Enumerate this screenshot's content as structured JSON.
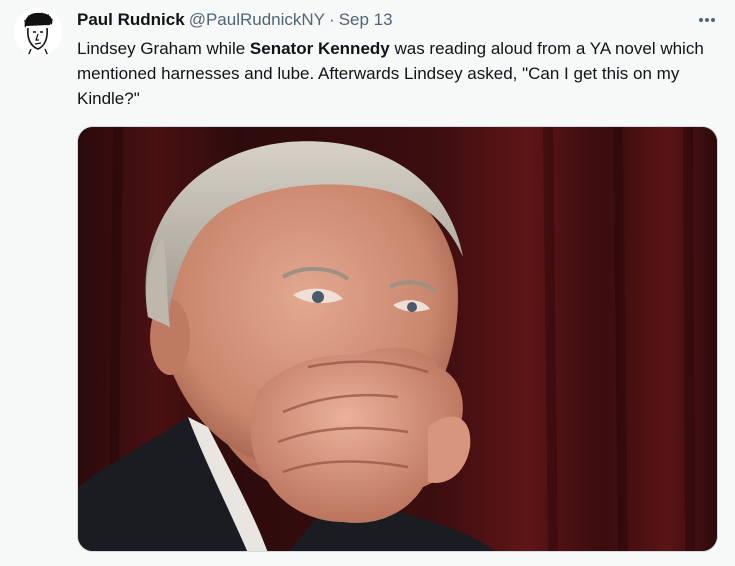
{
  "tweet": {
    "author_name": "Paul Rudnick",
    "author_handle": "@PaulRudnickNY",
    "separator": "·",
    "date": "Sep 13",
    "text": {
      "part1": "Lindsey Graham while ",
      "bold": "Senator Kennedy",
      "part2": " was reading aloud from a YA novel which mentioned harnesses and lube. Afterwards Lindsey asked, \"Can I get this on my Kindle?\""
    },
    "icons": {
      "more": "more-horizontal-icon",
      "avatar": "caricature-avatar"
    }
  },
  "colors": {
    "background": "#f7f9f9",
    "text_primary": "#0f1419",
    "text_secondary": "#536471",
    "curtain": "#5a1416"
  }
}
